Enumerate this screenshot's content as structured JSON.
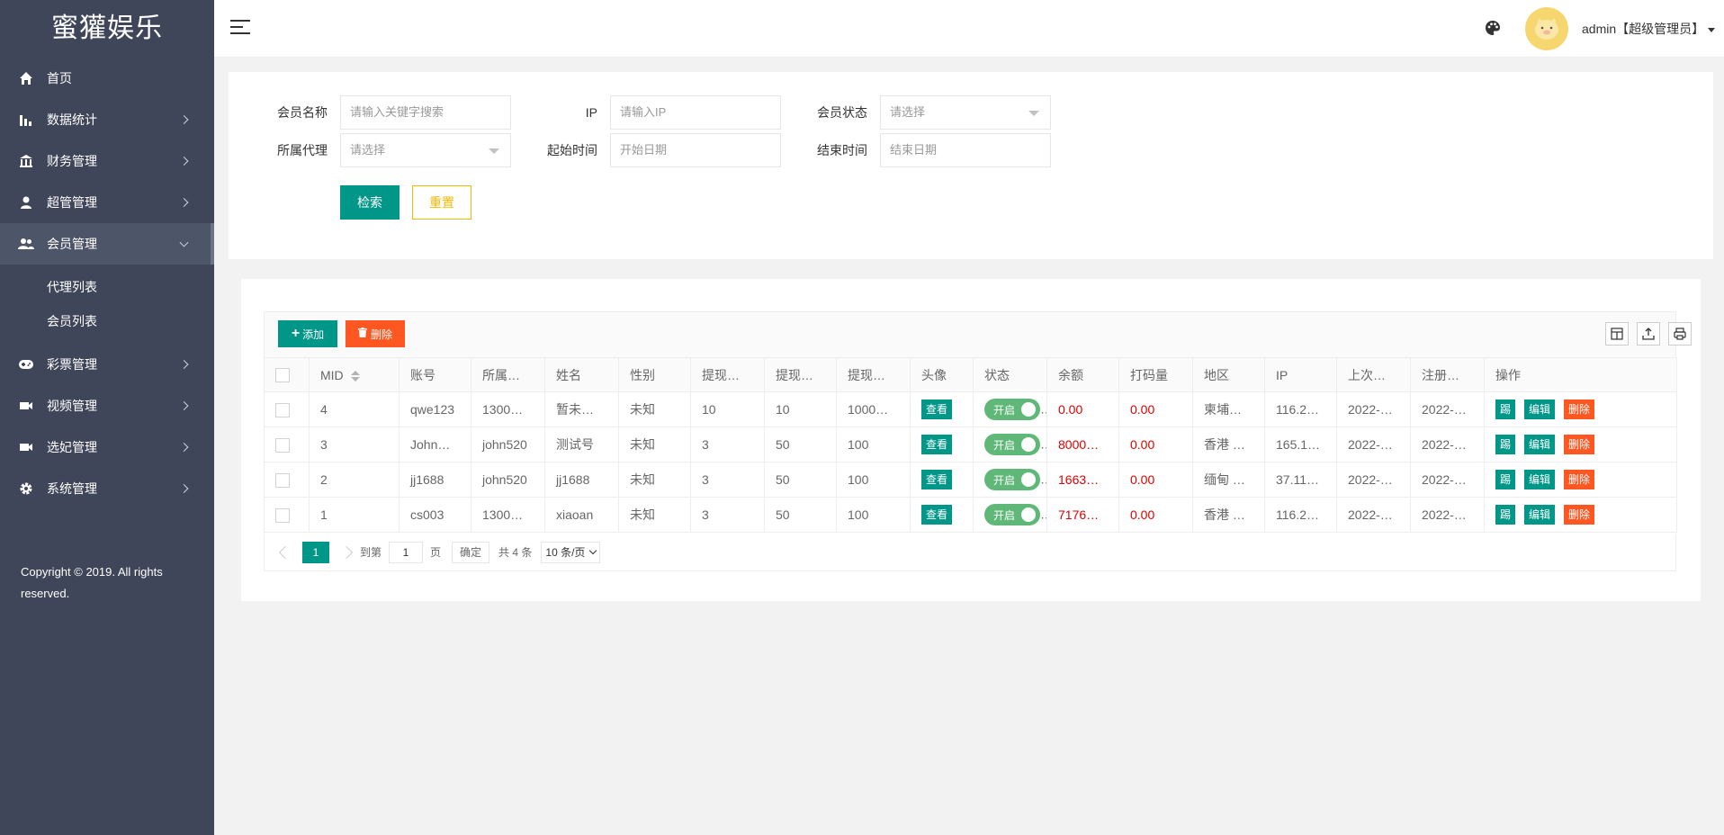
{
  "sidebar": {
    "brand": "蜜獾娱乐",
    "items": [
      {
        "label": "首页",
        "icon": "home-icon"
      },
      {
        "label": "数据统计",
        "icon": "bar-chart-icon"
      },
      {
        "label": "财务管理",
        "icon": "bank-icon"
      },
      {
        "label": "超管管理",
        "icon": "user-icon"
      },
      {
        "label": "会员管理",
        "icon": "users-icon"
      },
      {
        "label": "彩票管理",
        "icon": "gamepad-icon"
      },
      {
        "label": "视频管理",
        "icon": "video-icon"
      },
      {
        "label": "选妃管理",
        "icon": "video-icon"
      },
      {
        "label": "系统管理",
        "icon": "gear-icon"
      }
    ],
    "submenu": [
      "代理列表",
      "会员列表"
    ],
    "copyright": "Copyright © 2019. All rights reserved."
  },
  "header": {
    "user": "admin【超级管理员】"
  },
  "search": {
    "member_name_label": "会员名称",
    "member_name_placeholder": "请输入关键字搜索",
    "ip_label": "IP",
    "ip_placeholder": "请输入IP",
    "status_label": "会员状态",
    "status_value": "请选择",
    "agent_label": "所属代理",
    "agent_value": "请选择",
    "start_label": "起始时间",
    "start_placeholder": "开始日期",
    "end_label": "结束时间",
    "end_placeholder": "结束日期",
    "search_btn": "检索",
    "reset_btn": "重置"
  },
  "toolbar": {
    "add": "添加",
    "delete": "删除"
  },
  "table": {
    "columns": [
      "MID",
      "账号",
      "所属…",
      "姓名",
      "性别",
      "提现…",
      "提现…",
      "提现…",
      "头像",
      "状态",
      "余额",
      "打码量",
      "地区",
      "IP",
      "上次…",
      "注册…",
      "操作"
    ],
    "view_label": "查看",
    "switch_label": "开启",
    "op_t": "踢",
    "op_edit": "编辑",
    "op_delete": "删除",
    "rows": [
      {
        "mid": "4",
        "account": "qwe123",
        "agent": "1300…",
        "name": "暂未…",
        "gender": "未知",
        "w1": "10",
        "w2": "10",
        "w3": "1000…",
        "balance": "0.00",
        "code": "0.00",
        "region": "柬埔…",
        "ip": "116.2…",
        "last": "2022-…",
        "reg": "2022-…"
      },
      {
        "mid": "3",
        "account": "John…",
        "agent": "john520",
        "name": "测试号",
        "gender": "未知",
        "w1": "3",
        "w2": "50",
        "w3": "100",
        "balance": "8000…",
        "code": "0.00",
        "region": "香港 …",
        "ip": "165.1…",
        "last": "2022-…",
        "reg": "2022-…"
      },
      {
        "mid": "2",
        "account": "jj1688",
        "agent": "john520",
        "name": "jj1688",
        "gender": "未知",
        "w1": "3",
        "w2": "50",
        "w3": "100",
        "balance": "1663…",
        "code": "0.00",
        "region": "缅甸 …",
        "ip": "37.11…",
        "last": "2022-…",
        "reg": "2022-…"
      },
      {
        "mid": "1",
        "account": "cs003",
        "agent": "1300…",
        "name": "xiaoan",
        "gender": "未知",
        "w1": "3",
        "w2": "50",
        "w3": "100",
        "balance": "7176…",
        "code": "0.00",
        "region": "香港 …",
        "ip": "116.2…",
        "last": "2022-…",
        "reg": "2022-…"
      }
    ]
  },
  "pager": {
    "current": "1",
    "goto_label": "到第",
    "goto_value": "1",
    "page_label": "页",
    "ok_label": "确定",
    "total": "共 4 条",
    "page_size": "10 条/页"
  },
  "colors": {
    "sidebar": "#3f4659",
    "primary": "#009688",
    "danger": "#ff5722",
    "warning": "#f5b800",
    "switch": "#5fb878"
  }
}
